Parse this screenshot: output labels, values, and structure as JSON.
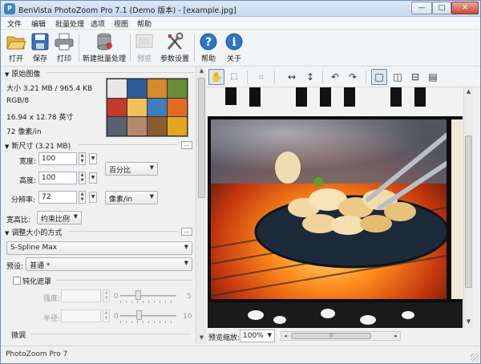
{
  "window": {
    "title": "BenVista PhotoZoom Pro 7.1 (Demo 版本) - [example.jpg]",
    "app_icon_glyph": "P",
    "controls": {
      "minimize": "—",
      "maximize": "□",
      "close": "✕"
    }
  },
  "menu": [
    "文件",
    "编辑",
    "批量处理",
    "选项",
    "视图",
    "帮助"
  ],
  "toolbar": {
    "open": "打开",
    "save": "保存",
    "print": "打印",
    "batch": "新建批量处理",
    "preview": "预览",
    "settings": "参数设置",
    "help": "帮助",
    "about": "关于"
  },
  "original": {
    "header": "原始图像",
    "size": "大小 3.21 MB / 965.4 KB",
    "mode": "RGB/8",
    "dimensions": "16.94 x 12.78 英寸",
    "resolution": "72 像素/in"
  },
  "new_size": {
    "header": "新尺寸 (3.21 MB)",
    "width_label": "宽度:",
    "width_value": "100",
    "height_label": "高度:",
    "height_value": "100",
    "resolution_label": "分辨率:",
    "resolution_value": "72",
    "unit_select": "百分比",
    "res_unit_select": "像素/in",
    "aspect_label": "宽高比:",
    "aspect_select": "约束比例",
    "ellipsis": "..."
  },
  "resize_method": {
    "header": "调整大小的方式",
    "method": "S-Spline Max",
    "preset_label": "预设:",
    "preset": "普通 *",
    "ellipsis": "..."
  },
  "unsharp": {
    "label": "钝化遮罩",
    "strength_label": "强度:",
    "radius_label": "半径:",
    "strength_min": "0",
    "strength_max": "5",
    "radius_min": "0",
    "radius_max": "10"
  },
  "finetune": {
    "header": "微调"
  },
  "preview_bottom": {
    "zoom_label": "预览缩放:",
    "zoom_value": "100%"
  },
  "status": "PhotoZoom Pro 7",
  "colors": {
    "titlebar": "#c5d9ef",
    "close_button": "#c24a3a",
    "active_toggle": "#dbe6f3",
    "help_icon": "#2f76c7"
  }
}
